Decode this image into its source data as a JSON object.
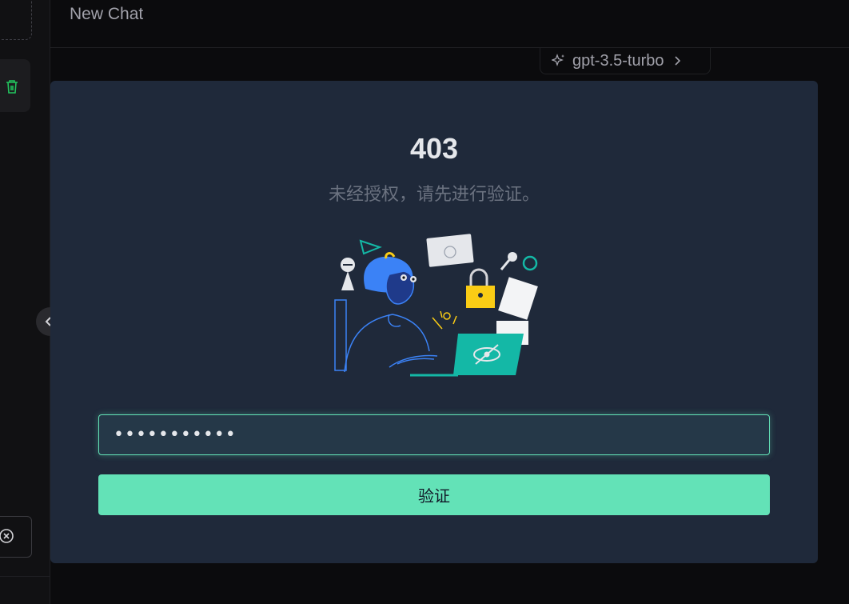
{
  "header": {
    "title": "New Chat"
  },
  "model_selector": {
    "label": "gpt-3.5-turbo"
  },
  "modal": {
    "code": "403",
    "message": "未经授权，请先进行验证。",
    "password_value": "***********",
    "verify_label": "验证"
  },
  "colors": {
    "accent": "#63e2b7",
    "modal_bg": "#1f293a",
    "page_bg": "#0b0b0d"
  },
  "icons": [
    "trash-icon",
    "chevron-left-icon",
    "clear-icon",
    "sparkle-icon",
    "chevron-right-icon"
  ]
}
